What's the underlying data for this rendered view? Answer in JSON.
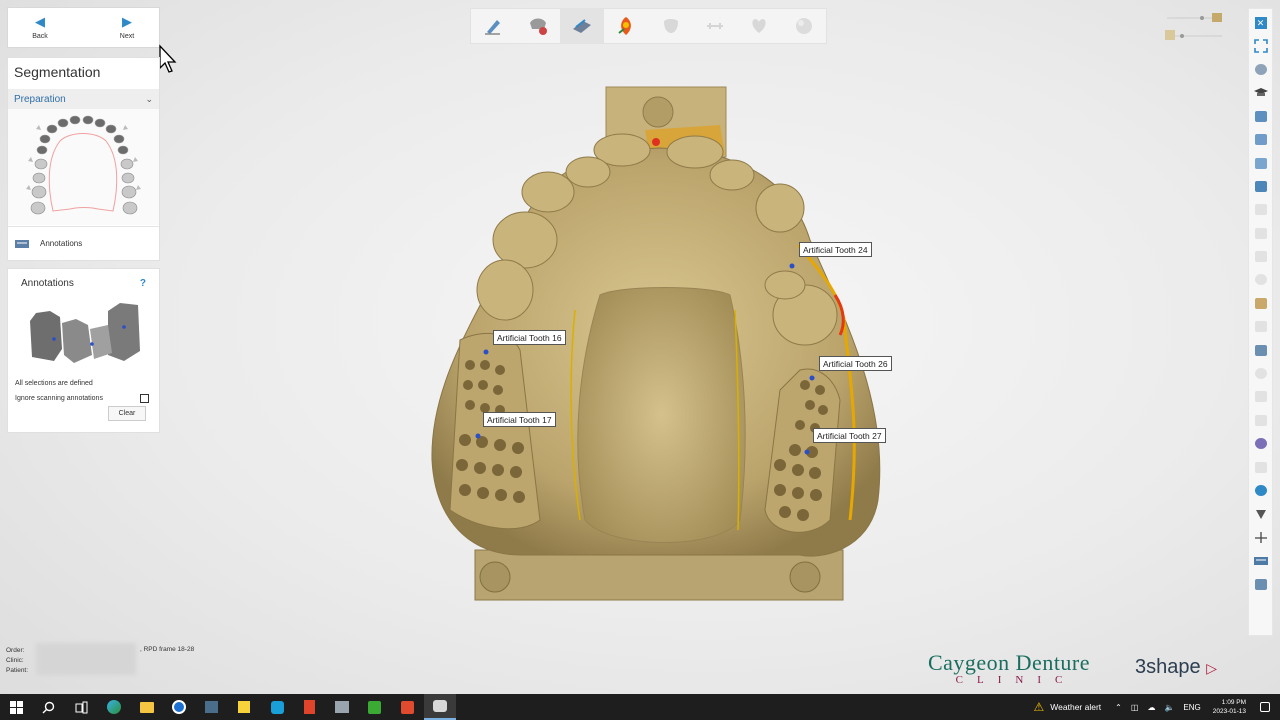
{
  "nav": {
    "back_label": "Back",
    "next_label": "Next"
  },
  "panel": {
    "title": "Segmentation",
    "section": "Preparation",
    "annotations_row": "Annotations"
  },
  "annotations_box": {
    "title": "Annotations",
    "help": "?",
    "status": "All selections are defined",
    "checkbox_label": "Ignore scanning annotations",
    "clear_label": "Clear"
  },
  "toolbar": {
    "tools": [
      "pencil-icon",
      "teeth-segment-icon",
      "scan-icon",
      "color-map-icon",
      "tooth-icon",
      "connector-icon",
      "heart-tooth-icon",
      "sphere-icon"
    ],
    "active_index": 2
  },
  "labels": {
    "t24": "Artificial Tooth 24",
    "t16": "Artificial Tooth 16",
    "t26": "Artificial Tooth 26",
    "t17": "Artificial Tooth 17",
    "t27": "Artificial Tooth 27"
  },
  "info": {
    "order_label": "Order:",
    "clinic_label": "Clinic:",
    "patient_label": "Patient:",
    "order_value": ", RPD frame 18-28"
  },
  "logos": {
    "clinic_name": "Caygeon Denture",
    "clinic_sub": "CLINIC",
    "brand": "3shape"
  },
  "taskbar": {
    "weather": "Weather alert",
    "lang": "ENG",
    "time": "1:09 PM",
    "date": "2023-01-13"
  },
  "colors": {
    "accent": "#2f89c7",
    "model": "#c8b47e",
    "clinic_green": "#1a6e60",
    "clinic_magenta": "#8a1a4a"
  }
}
